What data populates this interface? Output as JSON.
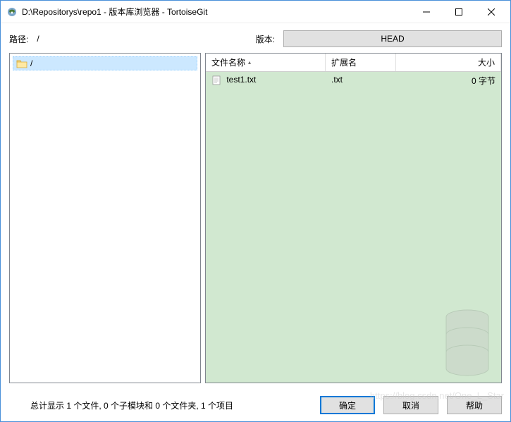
{
  "window": {
    "title": "D:\\Repositorys\\repo1 - 版本库浏览器 - TortoiseGit"
  },
  "topRow": {
    "pathLabel": "路径:",
    "pathValue": "/",
    "versionLabel": "版本:",
    "headButton": "HEAD"
  },
  "tree": {
    "rootLabel": "/"
  },
  "list": {
    "columns": {
      "name": "文件名称",
      "ext": "扩展名",
      "size": "大小"
    },
    "rows": [
      {
        "name": "test1.txt",
        "ext": ".txt",
        "size": "0 字节"
      }
    ]
  },
  "footer": {
    "status": "总计显示 1 个文件, 0 个子模块和 0 个文件夹, 1 个项目",
    "ok": "确定",
    "cancel": "取消",
    "help": "帮助"
  },
  "watermark": "https://blog.csdn.net/One_L_Star"
}
